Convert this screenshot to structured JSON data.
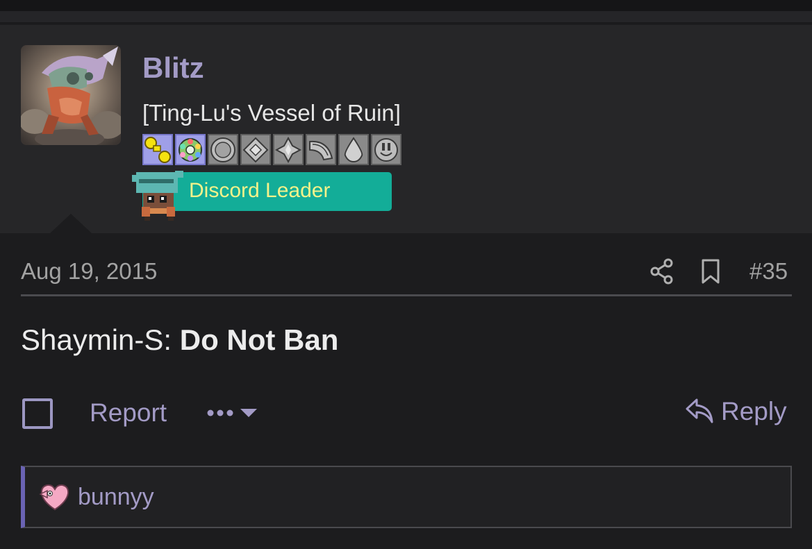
{
  "post": {
    "author": {
      "name": "Blitz",
      "title": "[Ting-Lu's Vessel of Ruin]",
      "role_banner": "Discord Leader"
    },
    "badges": [
      {
        "name": "boulder-badge-icon",
        "earned": true
      },
      {
        "name": "rainbow-badge-icon",
        "earned": true
      },
      {
        "name": "circle-badge-icon",
        "earned": false
      },
      {
        "name": "diamond-badge-icon",
        "earned": false
      },
      {
        "name": "spiky-badge-icon",
        "earned": false
      },
      {
        "name": "wing-badge-icon",
        "earned": false
      },
      {
        "name": "drop-badge-icon",
        "earned": false
      },
      {
        "name": "outlet-badge-icon",
        "earned": false
      }
    ],
    "date": "Aug 19, 2015",
    "number": "#35",
    "message": {
      "prefix": "Shaymin-S: ",
      "bold": "Do Not Ban"
    },
    "actions": {
      "report": "Report",
      "reply": "Reply"
    },
    "reactions": {
      "users": "bunnyy"
    }
  },
  "colors": {
    "accent": "#a39bc6",
    "role_banner_bg": "#13ad98",
    "role_banner_text": "#f4f28a",
    "background": "#1c1c1e",
    "user_block_bg": "#262628"
  }
}
